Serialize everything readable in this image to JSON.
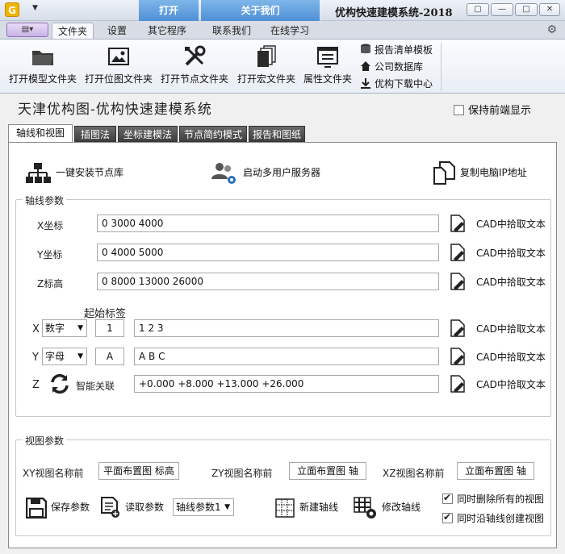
{
  "window": {
    "logo_letter": "G",
    "title": "优构快速建模系统-2018",
    "context_tabs": [
      "打开",
      "关于我们"
    ],
    "controls": [
      "restore",
      "minimize",
      "maximize",
      "close"
    ]
  },
  "ribbon_tabs": [
    "文件夹",
    "设置",
    "其它程序",
    "联系我们",
    "在线学习"
  ],
  "active_ribbon_tab": "文件夹",
  "ribbon_buttons": [
    {
      "label": "打开模型文件夹",
      "icon": "folder-icon"
    },
    {
      "label": "打开位图文件夹",
      "icon": "picture-icon"
    },
    {
      "label": "打开节点文件夹",
      "icon": "tools-icon"
    },
    {
      "label": "打开宏文件夹",
      "icon": "documents-icon"
    },
    {
      "label": "属性文件夹",
      "icon": "property-window-icon"
    }
  ],
  "ribbon_small": [
    {
      "label": "报告清单模板",
      "icon": "database-icon"
    },
    {
      "label": "公司数据库",
      "icon": "home-icon"
    },
    {
      "label": "优构下载中心",
      "icon": "download-icon"
    }
  ],
  "brand_title": "天津优构图-优构快速建模系统",
  "keep_front": {
    "label": "保持前端显示",
    "checked": false
  },
  "panel_tabs": [
    "轴线和视图",
    "插图法",
    "坐标建模法",
    "节点简约模式",
    "报告和图纸"
  ],
  "active_panel_tab": "轴线和视图",
  "tools": {
    "install": "一键安装节点库",
    "multiuser": "启动多用户服务器",
    "copyip": "复制电脑IP地址"
  },
  "axis": {
    "group_title": "轴线参数",
    "pick_label": "CAD中拾取文本",
    "x_label": "X坐标",
    "x_value": "0 3000 4000",
    "y_label": "Y坐标",
    "y_value": "0 4000 5000",
    "z_label": "Z标高",
    "z_value": "0 8000 13000 26000",
    "start_tag_label": "起始标签",
    "x_row": {
      "axis": "X",
      "type": "数字",
      "start": "1",
      "labels": "1 2 3"
    },
    "y_row": {
      "axis": "Y",
      "type": "字母",
      "start": "A",
      "labels": "A B C"
    },
    "z_row": {
      "axis": "Z",
      "smart_label": "智能关联",
      "value": "+0.000 +8.000 +13.000 +26.000"
    }
  },
  "view": {
    "group_title": "视图参数",
    "xy_label": "XY视图名称前",
    "xy_value": "平面布置图 标高",
    "zy_label": "ZY视图名称前",
    "zy_value": "立面布置图 轴",
    "xz_label": "XZ视图名称前",
    "xz_value": "立面布置图 轴",
    "save": "保存参数",
    "load": "读取参数",
    "param_select": "轴线参数1",
    "new_axis": "新建轴线",
    "modify_axis": "修改轴线",
    "opt_delete": {
      "label": "同时删除所有的视图",
      "checked": true
    },
    "opt_create": {
      "label": "同时沿轴线创建视图",
      "checked": true
    }
  }
}
